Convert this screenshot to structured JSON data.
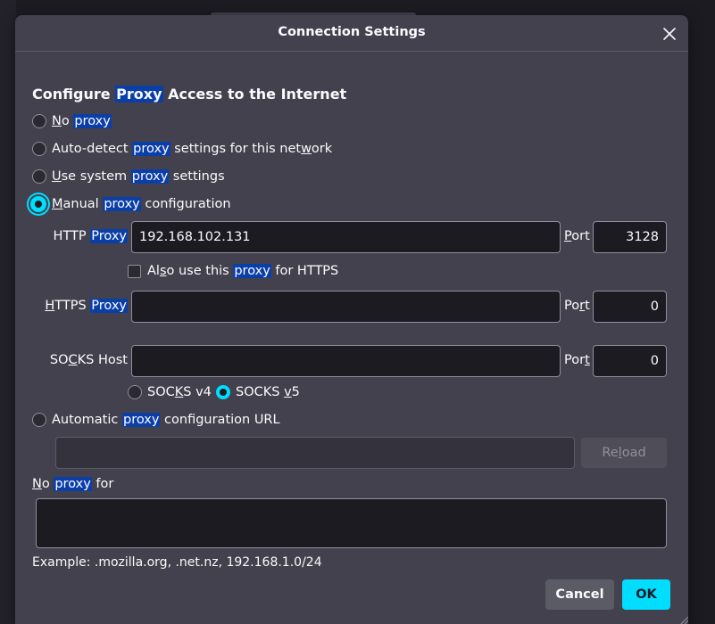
{
  "dialog": {
    "title": "Connection Settings",
    "heading_pre": "Configure ",
    "heading_hl": "Proxy",
    "heading_post": " Access to the Internet"
  },
  "options": {
    "no_proxy": {
      "u": "N",
      "pre": "o ",
      "hl": "proxy",
      "post": "",
      "selected": false
    },
    "auto_detect": {
      "pre": "Auto-detect ",
      "hl": "proxy",
      "post_a": " settings for this net",
      "u": "w",
      "post_b": "ork",
      "selected": false
    },
    "system": {
      "u": "U",
      "pre": "se system ",
      "hl": "proxy",
      "post": " settings",
      "selected": false
    },
    "manual": {
      "u": "M",
      "pre": "anual ",
      "hl": "proxy",
      "post": " configuration",
      "selected": true
    },
    "auto_url": {
      "pre": "Automatic ",
      "hl": "proxy",
      "post": " configuration URL",
      "selected": false
    }
  },
  "http": {
    "label_pre": "HTTP ",
    "label_hl": "Proxy",
    "value": "192.168.102.131",
    "port_u": "P",
    "port_rest": "ort",
    "port_value": "3128"
  },
  "also_https": {
    "pre": "Al",
    "u": "s",
    "mid": "o use this ",
    "hl": "proxy",
    "post": " for HTTPS",
    "checked": false
  },
  "https": {
    "label_u": "H",
    "label_pre": "TTPS ",
    "label_hl": "Proxy",
    "value": "",
    "port_pre": "Po",
    "port_u": "r",
    "port_rest": "t",
    "port_value": "0"
  },
  "socks": {
    "label_pre": "SO",
    "label_u": "C",
    "label_post": "KS Host",
    "value": "",
    "port_pre": "Por",
    "port_u": "t",
    "port_value": "0",
    "v4_pre": "SOC",
    "v4_u": "K",
    "v4_post": "S v4",
    "v5_pre": "SOCKS ",
    "v5_u": "v",
    "v5_post": "5",
    "selected_version": "v5"
  },
  "auto_url_value": "",
  "reload": {
    "pre": "Re",
    "u": "l",
    "post": "oad"
  },
  "no_proxy_for": {
    "u": "N",
    "pre": "o ",
    "hl": "proxy",
    "post": " for",
    "value": ""
  },
  "example": "Example: .mozilla.org, .net.nz, 192.168.1.0/24",
  "buttons": {
    "cancel": "Cancel",
    "ok": "OK"
  },
  "colors": {
    "accent": "#00ddff",
    "highlight": "#0b3fa8",
    "dialog_bg": "#42414d",
    "input_bg": "#1c1b22"
  }
}
